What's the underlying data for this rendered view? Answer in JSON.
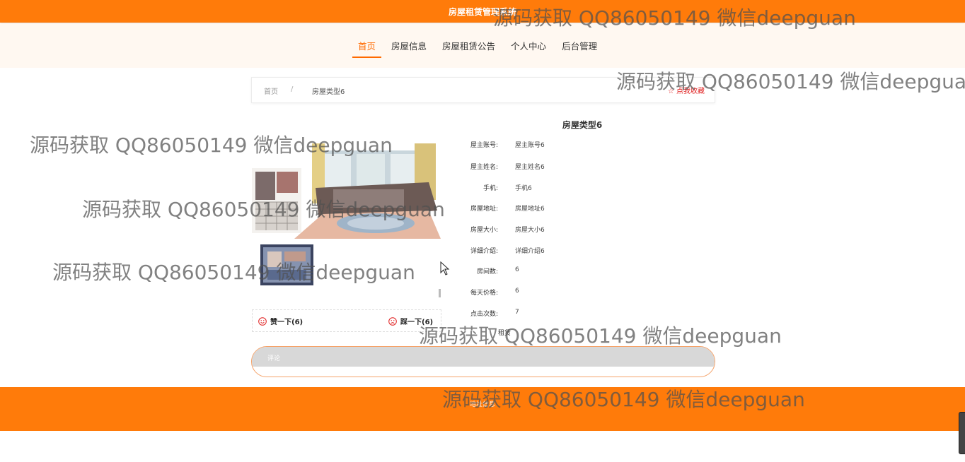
{
  "header": {
    "title": "房屋租赁管理系统"
  },
  "nav": {
    "items": [
      {
        "label": "首页",
        "active": true
      },
      {
        "label": "房屋信息",
        "active": false
      },
      {
        "label": "房屋租赁公告",
        "active": false
      },
      {
        "label": "个人中心",
        "active": false
      },
      {
        "label": "后台管理",
        "active": false
      }
    ]
  },
  "breadcrumb": {
    "home": "首页",
    "separator": "/",
    "current": "房屋类型6",
    "favorite": "☆ 点我收藏"
  },
  "detail": {
    "title": "房屋类型6",
    "fields": [
      {
        "label": "屋主账号:",
        "value": "屋主账号6"
      },
      {
        "label": "屋主姓名:",
        "value": "屋主姓名6"
      },
      {
        "label": "手机:",
        "value": "手机6"
      },
      {
        "label": "房屋地址:",
        "value": "房屋地址6"
      },
      {
        "label": "房屋大小:",
        "value": "房屋大小6"
      },
      {
        "label": "详细介绍:",
        "value": "详细介绍6"
      },
      {
        "label": "房间数:",
        "value": "6"
      },
      {
        "label": "每天价格:",
        "value": "6"
      },
      {
        "label": "点击次数:",
        "value": "7"
      }
    ],
    "rent_button": "租赁"
  },
  "votes": {
    "like_label": "赞一下(6)",
    "dislike_label": "踩一下(6)"
  },
  "comment": {
    "label": "评论"
  },
  "footer": {
    "text": "地址信息"
  },
  "watermark": {
    "text": "源码获取 QQ86050149 微信deepguan"
  },
  "colors": {
    "brand": "#ff7b0a",
    "accent": "#ff6a00",
    "favorite": "#e02020"
  },
  "icons": [
    "star-icon",
    "smile-icon",
    "frown-icon",
    "mouse-cursor-icon"
  ]
}
